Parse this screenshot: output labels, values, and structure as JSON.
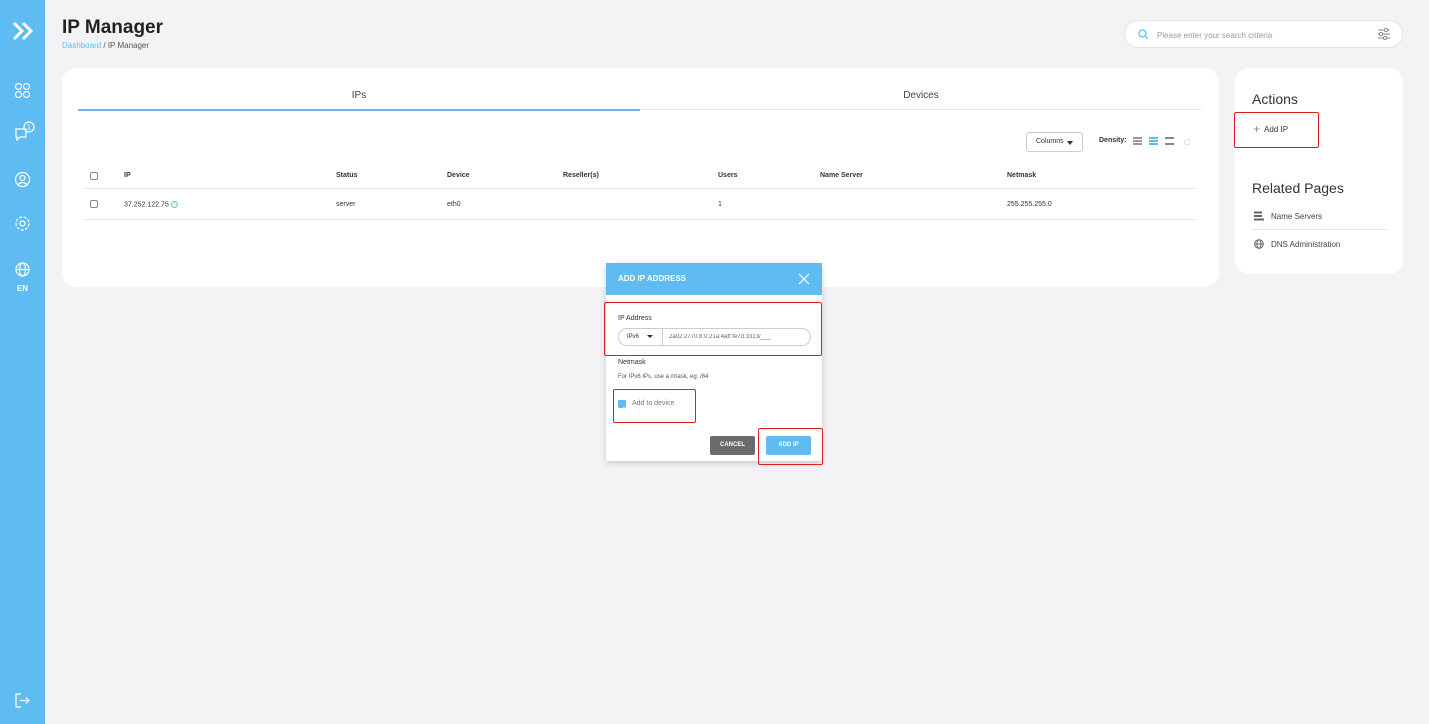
{
  "header": {
    "title": "IP Manager",
    "breadcrumb_link": "Dashboard",
    "breadcrumb_sep": " / ",
    "breadcrumb_current": "IP Manager"
  },
  "sidebar": {
    "language": "EN",
    "icons": [
      "dashboard-icon",
      "messages-icon",
      "account-icon",
      "settings-icon",
      "globe-icon",
      "logout-icon"
    ]
  },
  "search": {
    "placeholder": "Please enter your search criteria"
  },
  "tabs": [
    {
      "label": "IPs",
      "active": true
    },
    {
      "label": "Devices",
      "active": false
    }
  ],
  "toolbar": {
    "columns_label": "Columns",
    "density_label": "Density:"
  },
  "table": {
    "columns": [
      "IP",
      "Status",
      "Device",
      "Reseller(s)",
      "Users",
      "Name Server",
      "Netmask"
    ],
    "rows": [
      {
        "ip": "37.252.122.75",
        "status": "server",
        "device": "eth0",
        "resellers": "",
        "users": "1",
        "name_server": "",
        "netmask": "255.255.255.0"
      }
    ]
  },
  "actions": {
    "title": "Actions",
    "add_ip": "Add IP"
  },
  "related": {
    "title": "Related Pages",
    "items": [
      "Name Servers",
      "DNS Administration"
    ]
  },
  "dialog": {
    "title": "ADD IP ADDRESS",
    "ip_label": "IP Address",
    "ip_type": "IPv6",
    "ip_value": "2a02:2770:8:0:21a:4aff:fe7d:3313/___",
    "netmask_label": "Netmask",
    "netmask_hint": "For IPv6 IPs, use a /mask, eg: /64",
    "add_to_device_label": "Add to device",
    "add_to_device_checked": true,
    "cancel_label": "CANCEL",
    "add_label": "ADD IP"
  },
  "colors": {
    "accent": "#5ebcf3",
    "highlight": "#e02020",
    "cancel": "#6b6b6b"
  }
}
